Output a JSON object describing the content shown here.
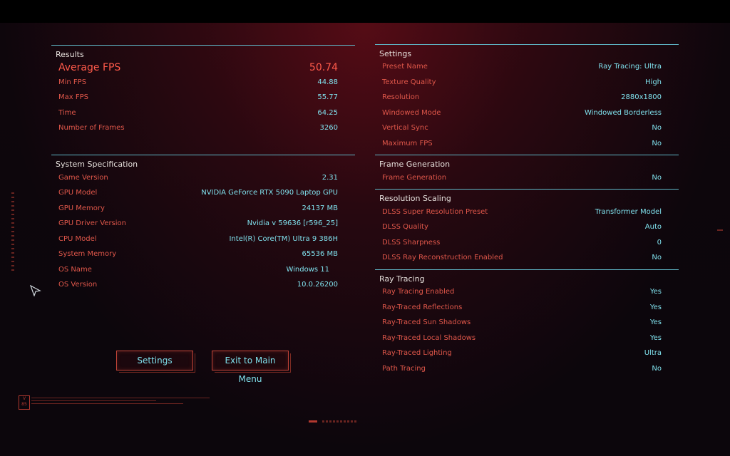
{
  "results": {
    "title": "Results",
    "average_fps": {
      "label": "Average FPS",
      "value": "50.74"
    },
    "rows": [
      {
        "label": "Min FPS",
        "value": "44.88"
      },
      {
        "label": "Max FPS",
        "value": "55.77"
      },
      {
        "label": "Time",
        "value": "64.25"
      },
      {
        "label": "Number of Frames",
        "value": "3260"
      }
    ]
  },
  "system": {
    "title": "System Specification",
    "rows": [
      {
        "label": "Game Version",
        "value": "2.31"
      },
      {
        "label": "GPU Model",
        "value": "NVIDIA GeForce RTX 5090 Laptop GPU"
      },
      {
        "label": "GPU Memory",
        "value": "24137 MB"
      },
      {
        "label": "GPU Driver Version",
        "value": "Nvidia v 59636 [r596_25]"
      },
      {
        "label": "CPU Model",
        "value": "Intel(R) Core(TM) Ultra 9 386H"
      },
      {
        "label": "System Memory",
        "value": "65536 MB"
      },
      {
        "label": "OS Name",
        "value": "Windows 11"
      },
      {
        "label": "OS Version",
        "value": "10.0.26200"
      }
    ]
  },
  "buttons": {
    "settings": "Settings",
    "exit": "Exit to Main Menu"
  },
  "settings": {
    "title": "Settings",
    "rows": [
      {
        "label": "Preset Name",
        "value": "Ray Tracing: Ultra"
      },
      {
        "label": "Texture Quality",
        "value": "High"
      },
      {
        "label": "Resolution",
        "value": "2880x1800"
      },
      {
        "label": "Windowed Mode",
        "value": "Windowed Borderless"
      },
      {
        "label": "Vertical Sync",
        "value": "No"
      },
      {
        "label": "Maximum FPS",
        "value": "No"
      }
    ]
  },
  "frame_generation": {
    "title": "Frame Generation",
    "rows": [
      {
        "label": "Frame Generation",
        "value": "No"
      }
    ]
  },
  "resolution_scaling": {
    "title": "Resolution Scaling",
    "rows": [
      {
        "label": "DLSS Super Resolution Preset",
        "value": "Transformer Model"
      },
      {
        "label": "DLSS Quality",
        "value": "Auto"
      },
      {
        "label": "DLSS Sharpness",
        "value": "0"
      },
      {
        "label": "DLSS Ray Reconstruction Enabled",
        "value": "No"
      }
    ]
  },
  "ray_tracing": {
    "title": "Ray Tracing",
    "rows": [
      {
        "label": "Ray Tracing Enabled",
        "value": "Yes"
      },
      {
        "label": "Ray-Traced Reflections",
        "value": "Yes"
      },
      {
        "label": "Ray-Traced Sun Shadows",
        "value": "Yes"
      },
      {
        "label": "Ray-Traced Local Shadows",
        "value": "Yes"
      },
      {
        "label": "Ray-Traced Lighting",
        "value": "Ultra"
      },
      {
        "label": "Path Tracing",
        "value": "No"
      }
    ]
  },
  "colors": {
    "accent_cyan": "#7fe0ec",
    "accent_red": "#e0574a",
    "divider": "#5fb7c7"
  },
  "icons": {
    "cursor": "pointer-cursor-icon",
    "version_badge": "version-badge-icon"
  }
}
